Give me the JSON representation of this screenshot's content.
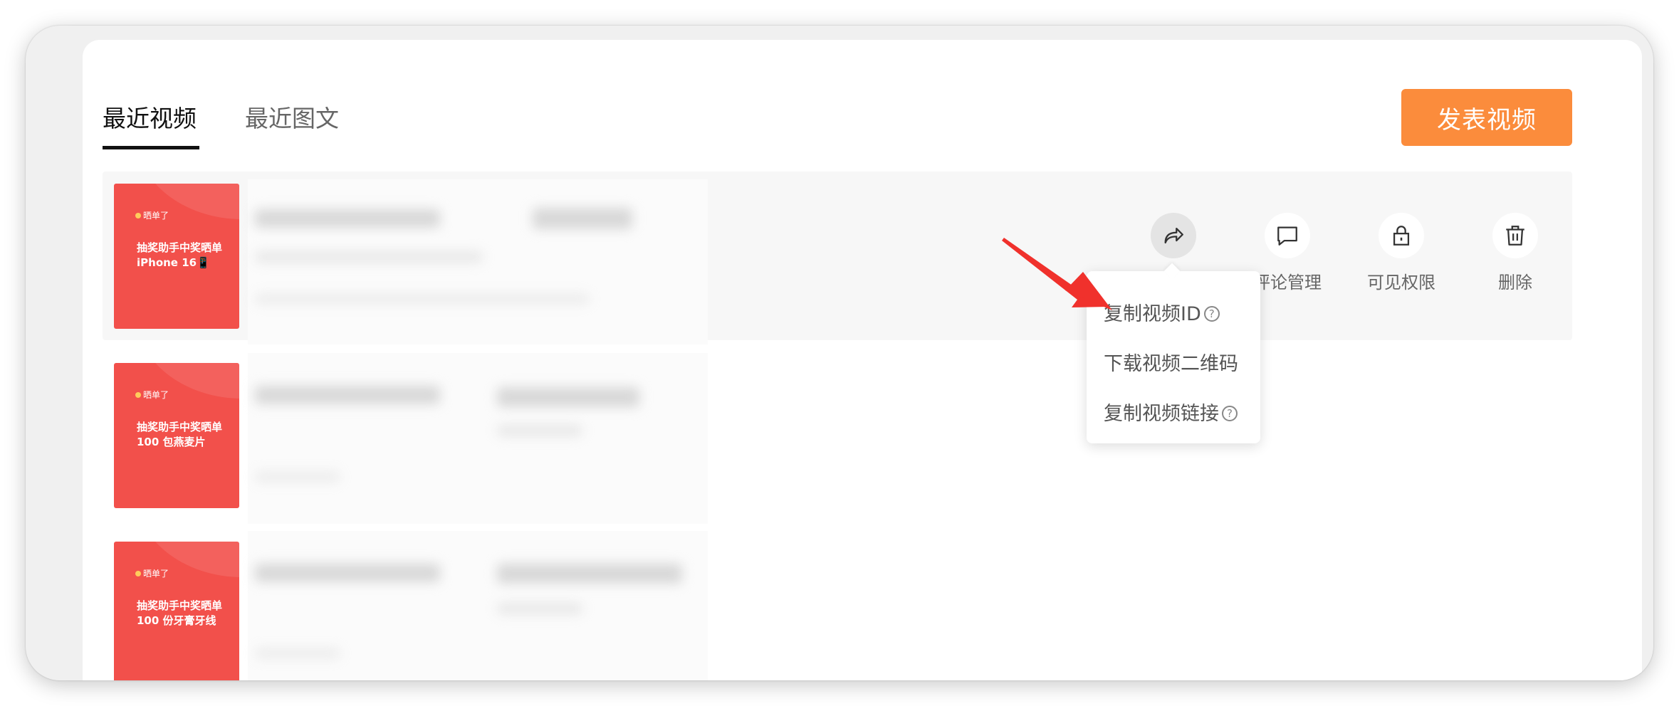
{
  "tabs": [
    {
      "label": "最近视频",
      "active": true
    },
    {
      "label": "最近图文",
      "active": false
    }
  ],
  "publish_button": {
    "label": "发表视频",
    "color": "#fb8c3c"
  },
  "videos": [
    {
      "tag": "晒单了",
      "title": "抽奖助手中奖晒单 iPhone 16📱"
    },
    {
      "tag": "晒单了",
      "title": "抽奖助手中奖晒单 100 包燕麦片"
    },
    {
      "tag": "晒单了",
      "title": "抽奖助手中奖晒单 100 份牙膏牙线"
    }
  ],
  "actions": [
    {
      "name": "share",
      "icon": "share-icon",
      "label": ""
    },
    {
      "name": "comments",
      "icon": "comment-icon",
      "label": "评论管理"
    },
    {
      "name": "visibility",
      "icon": "lock-icon",
      "label": "可见权限"
    },
    {
      "name": "delete",
      "icon": "trash-icon",
      "label": "删除"
    }
  ],
  "share_menu": {
    "items": [
      {
        "label": "复制视频ID",
        "help": "?"
      },
      {
        "label": "下载视频二维码",
        "help": ""
      },
      {
        "label": "复制视频链接",
        "help": "?"
      }
    ]
  },
  "colors": {
    "accent": "#fb8c3c",
    "thumbnail": "#f2504b",
    "annotation_arrow": "#f0312c"
  }
}
